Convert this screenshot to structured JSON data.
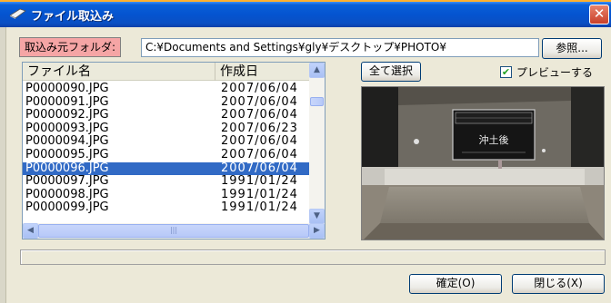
{
  "window": {
    "title": "ファイル取込み",
    "close_glyph": "✕"
  },
  "folder": {
    "label": "取込み元フォルダ:",
    "path": "C:¥Documents and Settings¥gly¥デスクトップ¥PHOTO¥",
    "browse_label": "参照..."
  },
  "filelist": {
    "columns": [
      "ファイル名",
      "作成日"
    ],
    "rows": [
      {
        "name": "P0000090.JPG",
        "date": "2007/06/04"
      },
      {
        "name": "P0000091.JPG",
        "date": "2007/06/04"
      },
      {
        "name": "P0000092.JPG",
        "date": "2007/06/04"
      },
      {
        "name": "P0000093.JPG",
        "date": "2007/06/23"
      },
      {
        "name": "P0000094.JPG",
        "date": "2007/06/04"
      },
      {
        "name": "P0000095.JPG",
        "date": "2007/06/04"
      },
      {
        "name": "P0000096.JPG",
        "date": "2007/06/04"
      },
      {
        "name": "P0000097.JPG",
        "date": "1991/01/24"
      },
      {
        "name": "P0000098.JPG",
        "date": "1991/01/24"
      },
      {
        "name": "P0000099.JPG",
        "date": "1991/01/24"
      }
    ],
    "selected_index": 6
  },
  "actions": {
    "select_all_label": "全て選択",
    "preview_label": "プレビューする",
    "preview_checked": true,
    "ok_label": "確定(O)",
    "close_label": "閉じる(X)"
  },
  "preview": {
    "sign_text": "沖土後"
  },
  "colors": {
    "titlebar": "#0454d0",
    "selection": "#316ac5",
    "folder_label_bg": "#f5a5a5"
  }
}
